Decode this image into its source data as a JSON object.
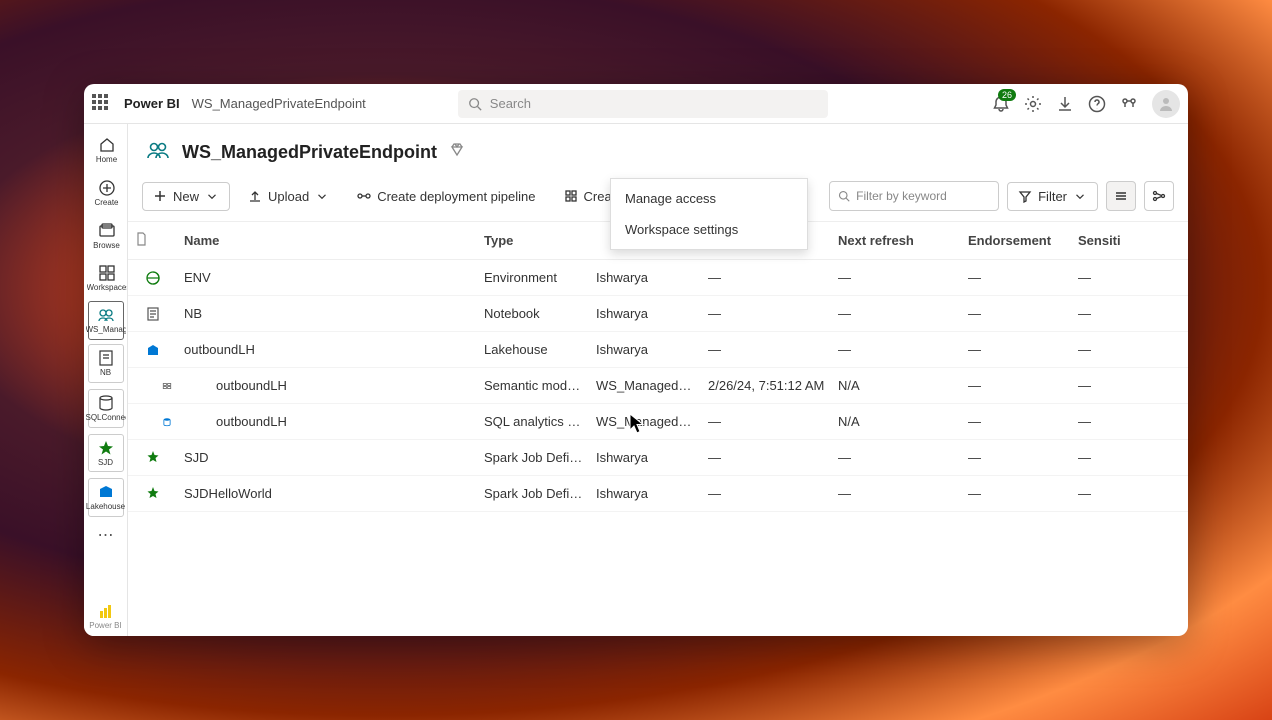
{
  "app": {
    "brand": "Power BI",
    "breadcrumb": "WS_ManagedPrivateEndpoint",
    "search_placeholder": "Search",
    "notification_count": "26"
  },
  "leftnav": {
    "home": "Home",
    "create": "Create",
    "browse": "Browse",
    "workspaces": "Workspaces",
    "ws_managed": "WS_ManagedPrivateE...",
    "nb": "NB",
    "sqlconnect": "SQLConnect",
    "sjd": "SJD",
    "lakehouse": "Lakehouse",
    "powerbi": "Power BI"
  },
  "workspace": {
    "title": "WS_ManagedPrivateEndpoint"
  },
  "toolbar": {
    "new": "New",
    "upload": "Upload",
    "pipeline": "Create deployment pipeline",
    "createapp": "Create app",
    "filter_placeholder": "Filter by keyword",
    "filter": "Filter"
  },
  "columns": {
    "name": "Name",
    "type": "Type",
    "owner": "",
    "refreshed": "",
    "next_refresh": "Next refresh",
    "endorsement": "Endorsement",
    "sensitivity": "Sensiti"
  },
  "menu": {
    "manage_access": "Manage access",
    "workspace_settings": "Workspace settings"
  },
  "rows": [
    {
      "name": "ENV",
      "type": "Environment",
      "owner": "Ishwarya",
      "refreshed": "—",
      "next": "—",
      "endorse": "—",
      "sens": "—",
      "icon": "env"
    },
    {
      "name": "NB",
      "type": "Notebook",
      "owner": "Ishwarya",
      "refreshed": "—",
      "next": "—",
      "endorse": "—",
      "sens": "—",
      "icon": "notebook"
    },
    {
      "name": "outboundLH",
      "type": "Lakehouse",
      "owner": "Ishwarya",
      "refreshed": "—",
      "next": "—",
      "endorse": "—",
      "sens": "—",
      "icon": "lakehouse"
    },
    {
      "name": "outboundLH",
      "type": "Semantic model (...",
      "owner": "WS_ManagedPriv...",
      "refreshed": "2/26/24, 7:51:12 AM",
      "next": "N/A",
      "endorse": "—",
      "sens": "—",
      "icon": "model",
      "sub": true
    },
    {
      "name": "outboundLH",
      "type": "SQL analytics end...",
      "owner": "WS_ManagedPriv...",
      "refreshed": "—",
      "next": "N/A",
      "endorse": "—",
      "sens": "—",
      "icon": "sql",
      "sub": true
    },
    {
      "name": "SJD",
      "type": "Spark Job Definiti...",
      "owner": "Ishwarya",
      "refreshed": "—",
      "next": "—",
      "endorse": "—",
      "sens": "—",
      "icon": "spark"
    },
    {
      "name": "SJDHelloWorld",
      "type": "Spark Job Definiti...",
      "owner": "Ishwarya",
      "refreshed": "—",
      "next": "—",
      "endorse": "—",
      "sens": "—",
      "icon": "spark"
    }
  ]
}
